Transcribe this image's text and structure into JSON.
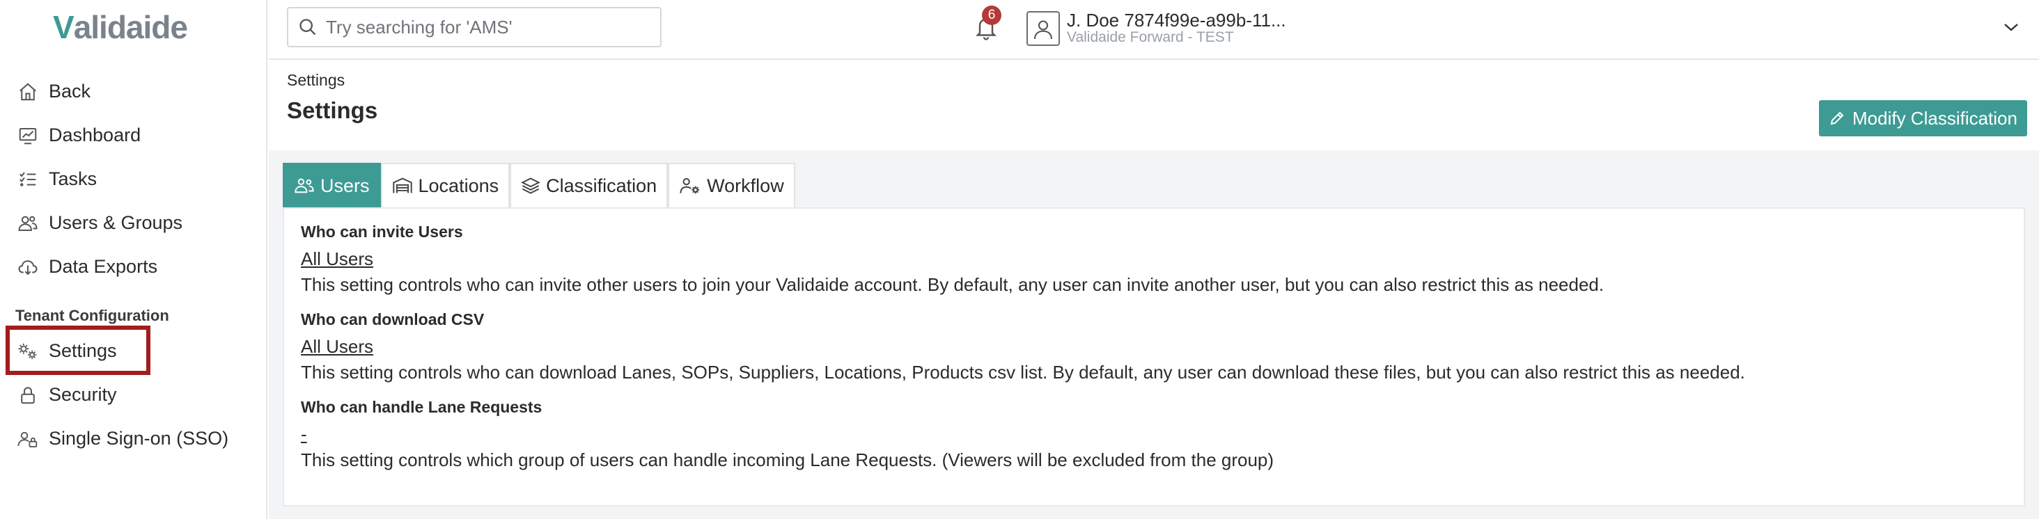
{
  "brand": {
    "logo_v": "V",
    "logo_rest": "alidaide"
  },
  "search": {
    "placeholder": "Try searching for 'AMS'"
  },
  "notifications": {
    "count": "6"
  },
  "user": {
    "name": "J. Doe 7874f99e-a99b-11...",
    "org": "Validaide Forward - TEST"
  },
  "sidebar": {
    "items": [
      {
        "label": "Back",
        "icon": "home-icon"
      },
      {
        "label": "Dashboard",
        "icon": "dashboard-icon"
      },
      {
        "label": "Tasks",
        "icon": "tasks-icon"
      },
      {
        "label": "Users & Groups",
        "icon": "users-icon"
      },
      {
        "label": "Data Exports",
        "icon": "cloud-download-icon"
      }
    ],
    "section_title": "Tenant Configuration",
    "config_items": [
      {
        "label": "Settings",
        "icon": "gears-icon"
      },
      {
        "label": "Security",
        "icon": "lock-icon"
      },
      {
        "label": "Single Sign-on (SSO)",
        "icon": "user-lock-icon"
      }
    ]
  },
  "header": {
    "breadcrumb": "Settings",
    "title": "Settings",
    "modify_label": "Modify Classification"
  },
  "tabs": [
    {
      "label": "Users",
      "icon": "users-icon",
      "active": true
    },
    {
      "label": "Locations",
      "icon": "warehouse-icon",
      "active": false
    },
    {
      "label": "Classification",
      "icon": "layers-icon",
      "active": false
    },
    {
      "label": "Workflow",
      "icon": "user-gear-icon",
      "active": false
    }
  ],
  "settings": [
    {
      "label": "Who can invite Users",
      "value": "All Users",
      "description": "This setting controls who can invite other users to join your Validaide account. By default, any user can invite another user, but you can also restrict this as needed."
    },
    {
      "label": "Who can download CSV",
      "value": "All Users",
      "description": "This setting controls who can download Lanes, SOPs, Suppliers, Locations, Products csv list. By default, any user can download these files, but you can also restrict this as needed."
    },
    {
      "label": "Who can handle Lane Requests",
      "value": "-",
      "description": "This setting controls which group of users can handle incoming Lane Requests. (Viewers will be excluded from the group)"
    }
  ],
  "colors": {
    "accent": "#3d9b94",
    "highlight": "#a31d1d",
    "badge": "#b23a3a"
  }
}
